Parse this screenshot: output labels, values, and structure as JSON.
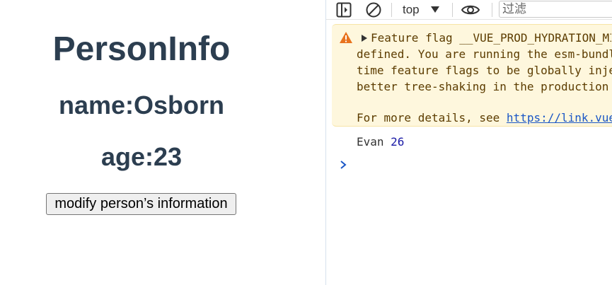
{
  "app": {
    "title": "PersonInfo",
    "name_line": "name:Osborn",
    "age_line": "age:23",
    "modify_button": "modify person’s information"
  },
  "devtools": {
    "toolbar": {
      "context": "top",
      "filter_placeholder": "过滤"
    },
    "warning": {
      "line1": "Feature flag __VUE_PROD_HYDRATION_MISMATCH_DETAILS__ is not explicitly",
      "line2": "defined. You are running the esm-bundler build of Vue, which expects these compile-",
      "line3": "time feature flags to be globally injected via the bundler config in order to get",
      "line4": "better tree-shaking in the production bundle.",
      "details_prefix": "For more details, see ",
      "details_link": "https://link.vuejs.org/feature-flags"
    },
    "log": {
      "text": "Evan",
      "number": "26"
    }
  },
  "colors": {
    "heading": "#2c3e50",
    "warning_bg": "#fef7dd",
    "warning_icon": "#e8731e",
    "link": "#1a56c6",
    "log_number": "#1a1aa6"
  }
}
